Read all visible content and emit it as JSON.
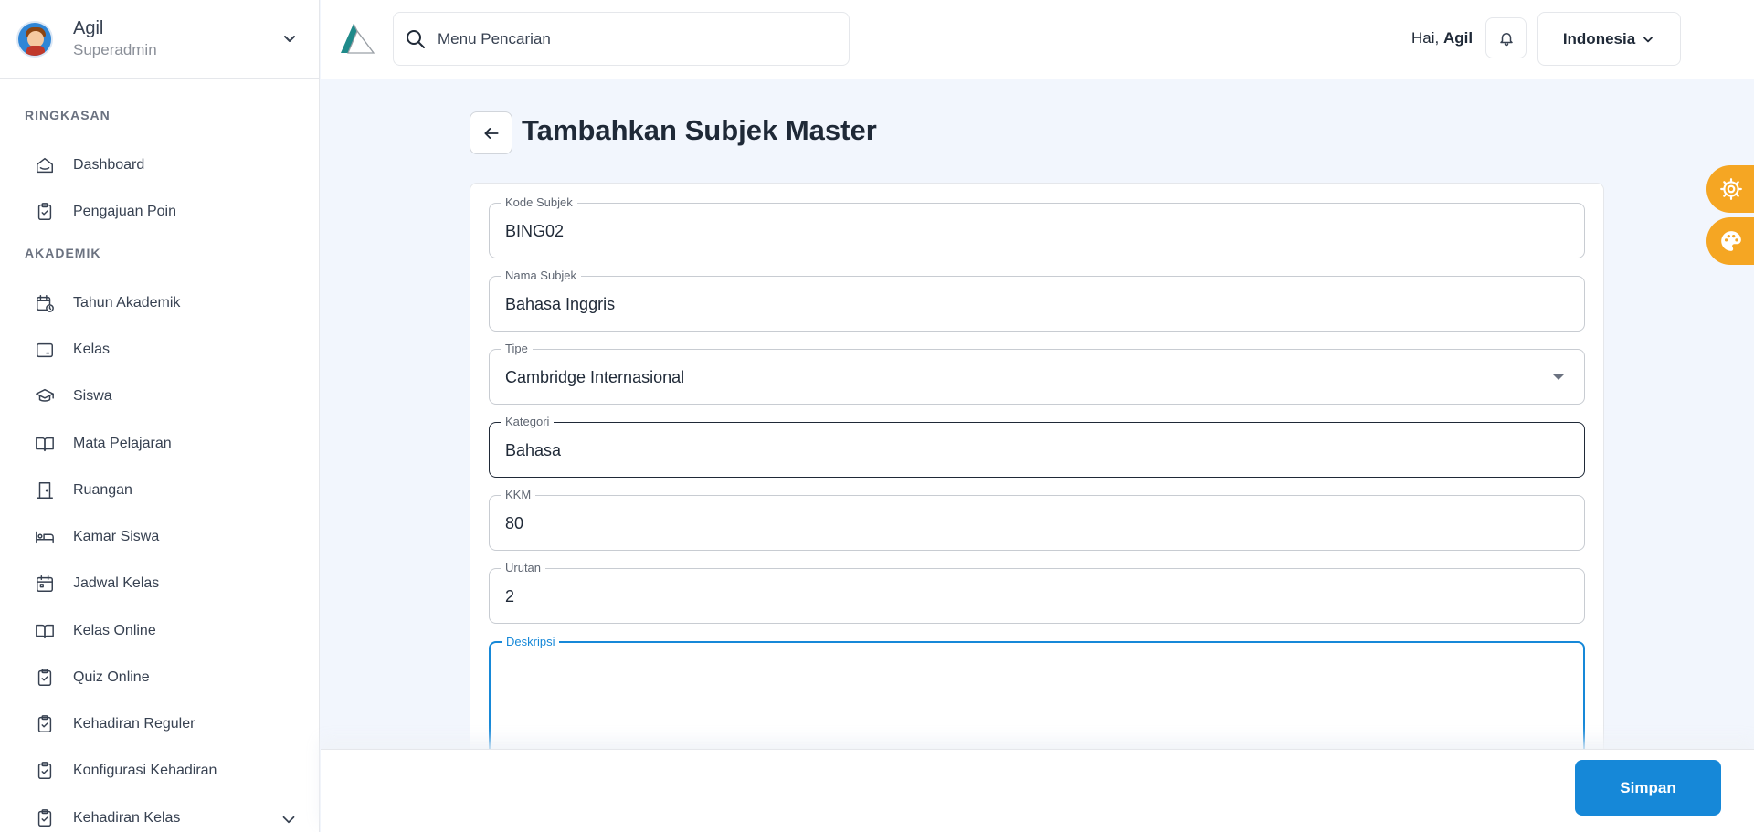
{
  "profile": {
    "name": "Agil",
    "role": "Superadmin"
  },
  "sidebar": {
    "sections": [
      {
        "title": "RINGKASAN"
      },
      {
        "title": "AKADEMIK"
      }
    ],
    "items": [
      {
        "label": "Dashboard",
        "icon": "home-icon"
      },
      {
        "label": "Pengajuan Poin",
        "icon": "clipboard-check-icon"
      },
      {
        "label": "Tahun Akademik",
        "icon": "calendar-clock-icon"
      },
      {
        "label": "Kelas",
        "icon": "tablet-icon"
      },
      {
        "label": "Siswa",
        "icon": "graduation-cap-icon"
      },
      {
        "label": "Mata Pelajaran",
        "icon": "book-open-icon"
      },
      {
        "label": "Ruangan",
        "icon": "door-icon"
      },
      {
        "label": "Kamar Siswa",
        "icon": "bed-icon"
      },
      {
        "label": "Jadwal Kelas",
        "icon": "calendar-icon"
      },
      {
        "label": "Kelas Online",
        "icon": "book-open-icon"
      },
      {
        "label": "Quiz Online",
        "icon": "clipboard-check-icon"
      },
      {
        "label": "Kehadiran Reguler",
        "icon": "clipboard-check-icon"
      },
      {
        "label": "Konfigurasi Kehadiran",
        "icon": "clipboard-check-icon"
      },
      {
        "label": "Kehadiran Kelas",
        "icon": "clipboard-check-icon"
      }
    ]
  },
  "header": {
    "search_placeholder": "Menu Pencarian",
    "greeting_prefix": "Hai,",
    "greeting_name": "Agil",
    "language": "Indonesia"
  },
  "page": {
    "title": "Tambahkan Subjek Master"
  },
  "form": {
    "kode": {
      "label": "Kode Subjek",
      "value": "BING02"
    },
    "nama": {
      "label": "Nama Subjek",
      "value": "Bahasa Inggris"
    },
    "tipe": {
      "label": "Tipe",
      "value": "Cambridge Internasional"
    },
    "kategori": {
      "label": "Kategori",
      "value": "Bahasa"
    },
    "kkm": {
      "label": "KKM",
      "value": "80"
    },
    "urutan": {
      "label": "Urutan",
      "value": "2"
    },
    "deskripsi": {
      "label": "Deskripsi",
      "value": ""
    }
  },
  "footer": {
    "save_label": "Simpan"
  },
  "colors": {
    "primary": "#1688d8",
    "accent": "#f5a623",
    "background": "#f2f6fd",
    "logo_teal": "#1f8a8a"
  }
}
